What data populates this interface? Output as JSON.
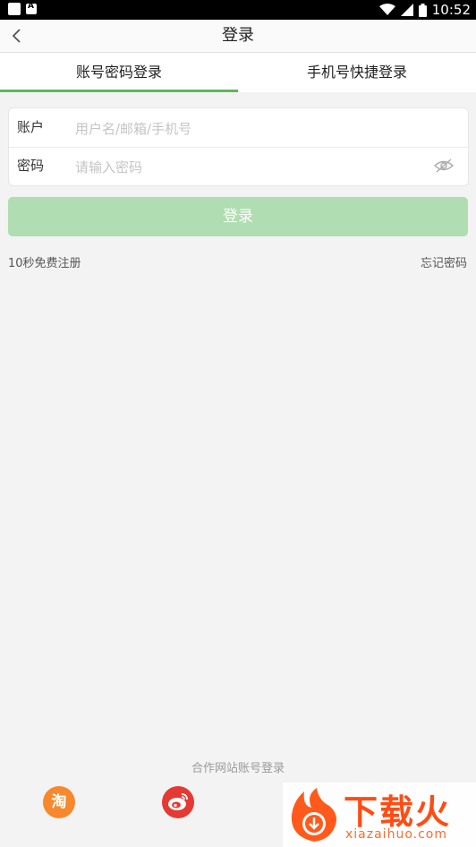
{
  "status_bar": {
    "time": "10:52"
  },
  "header": {
    "title": "登录"
  },
  "tabs": [
    {
      "label": "账号密码登录",
      "active": true
    },
    {
      "label": "手机号快捷登录",
      "active": false
    }
  ],
  "form": {
    "account_label": "账户",
    "account_placeholder": "用户名/邮箱/手机号",
    "password_label": "密码",
    "password_placeholder": "请输入密码"
  },
  "login_button": "登录",
  "register_link": "10秒免费注册",
  "forgot_link": "忘记密码",
  "partner_login": {
    "heading": "合作网站账号登录",
    "providers": [
      {
        "name": "taobao",
        "glyph": "淘",
        "icon": "taobao-icon",
        "color": "#f7882d"
      },
      {
        "name": "weibo",
        "icon": "weibo-icon",
        "color": "#e33a33"
      }
    ]
  },
  "watermark": {
    "title": "下载火",
    "url": "xiazaihuo.com"
  },
  "colors": {
    "accent": "#5cb85c",
    "button_disabled": "#b0ddb1"
  }
}
